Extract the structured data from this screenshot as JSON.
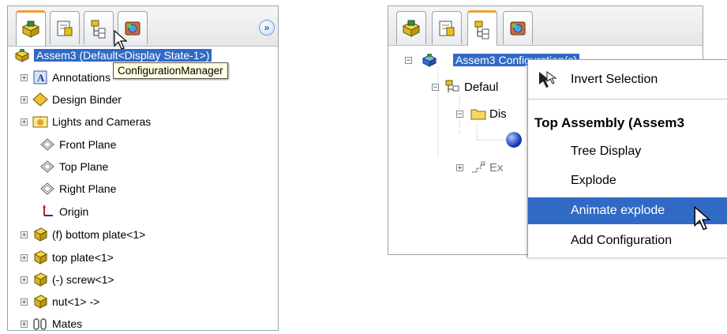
{
  "left_panel": {
    "tabs": [
      {
        "name": "feature-manager-tab"
      },
      {
        "name": "property-manager-tab"
      },
      {
        "name": "configuration-manager-tab"
      },
      {
        "name": "display-manager-tab"
      }
    ],
    "expand_button": "»",
    "root_label": "Assem3  (Default<Display State-1>)",
    "tooltip": "ConfigurationManager",
    "items": [
      {
        "label": "Annotations",
        "icon": "annotations-icon",
        "expandable": true
      },
      {
        "label": "Design Binder",
        "icon": "design-binder-icon",
        "expandable": true
      },
      {
        "label": "Lights and Cameras",
        "icon": "lights-cameras-icon",
        "expandable": true
      },
      {
        "label": "Front Plane",
        "icon": "plane-icon",
        "expandable": false
      },
      {
        "label": "Top Plane",
        "icon": "plane-icon",
        "expandable": false
      },
      {
        "label": "Right Plane",
        "icon": "plane-icon",
        "expandable": false
      },
      {
        "label": "Origin",
        "icon": "origin-icon",
        "expandable": false
      },
      {
        "label": "(f) bottom plate<1>",
        "icon": "part-icon",
        "expandable": true
      },
      {
        "label": "top plate<1>",
        "icon": "part-icon",
        "expandable": true
      },
      {
        "label": "(-) screw<1>",
        "icon": "part-icon",
        "expandable": true
      },
      {
        "label": "nut<1> ->",
        "icon": "part-icon",
        "expandable": true
      },
      {
        "label": "Mates",
        "icon": "mates-icon",
        "expandable": true
      }
    ]
  },
  "right_panel": {
    "root_label": "Assem3 Configuration(s)",
    "tree": [
      {
        "label": "Defaul",
        "icon": "configuration-icon"
      },
      {
        "label": "Dis",
        "icon": "folder-icon"
      },
      {
        "label": "",
        "icon": "display-state-icon"
      },
      {
        "label": "Ex",
        "icon": "explode-icon"
      }
    ]
  },
  "context_menu": {
    "invert_selection": "Invert Selection",
    "header": "Top Assembly (Assem3",
    "items": [
      "Tree Display",
      "Explode",
      "Animate explode",
      "Add Configuration"
    ],
    "highlighted_index": 2
  },
  "colors": {
    "selection": "#316ac5",
    "tooltip_bg": "#ffffe1",
    "part_yellow": "#e8c020",
    "active_tab_accent": "#f0a030"
  }
}
